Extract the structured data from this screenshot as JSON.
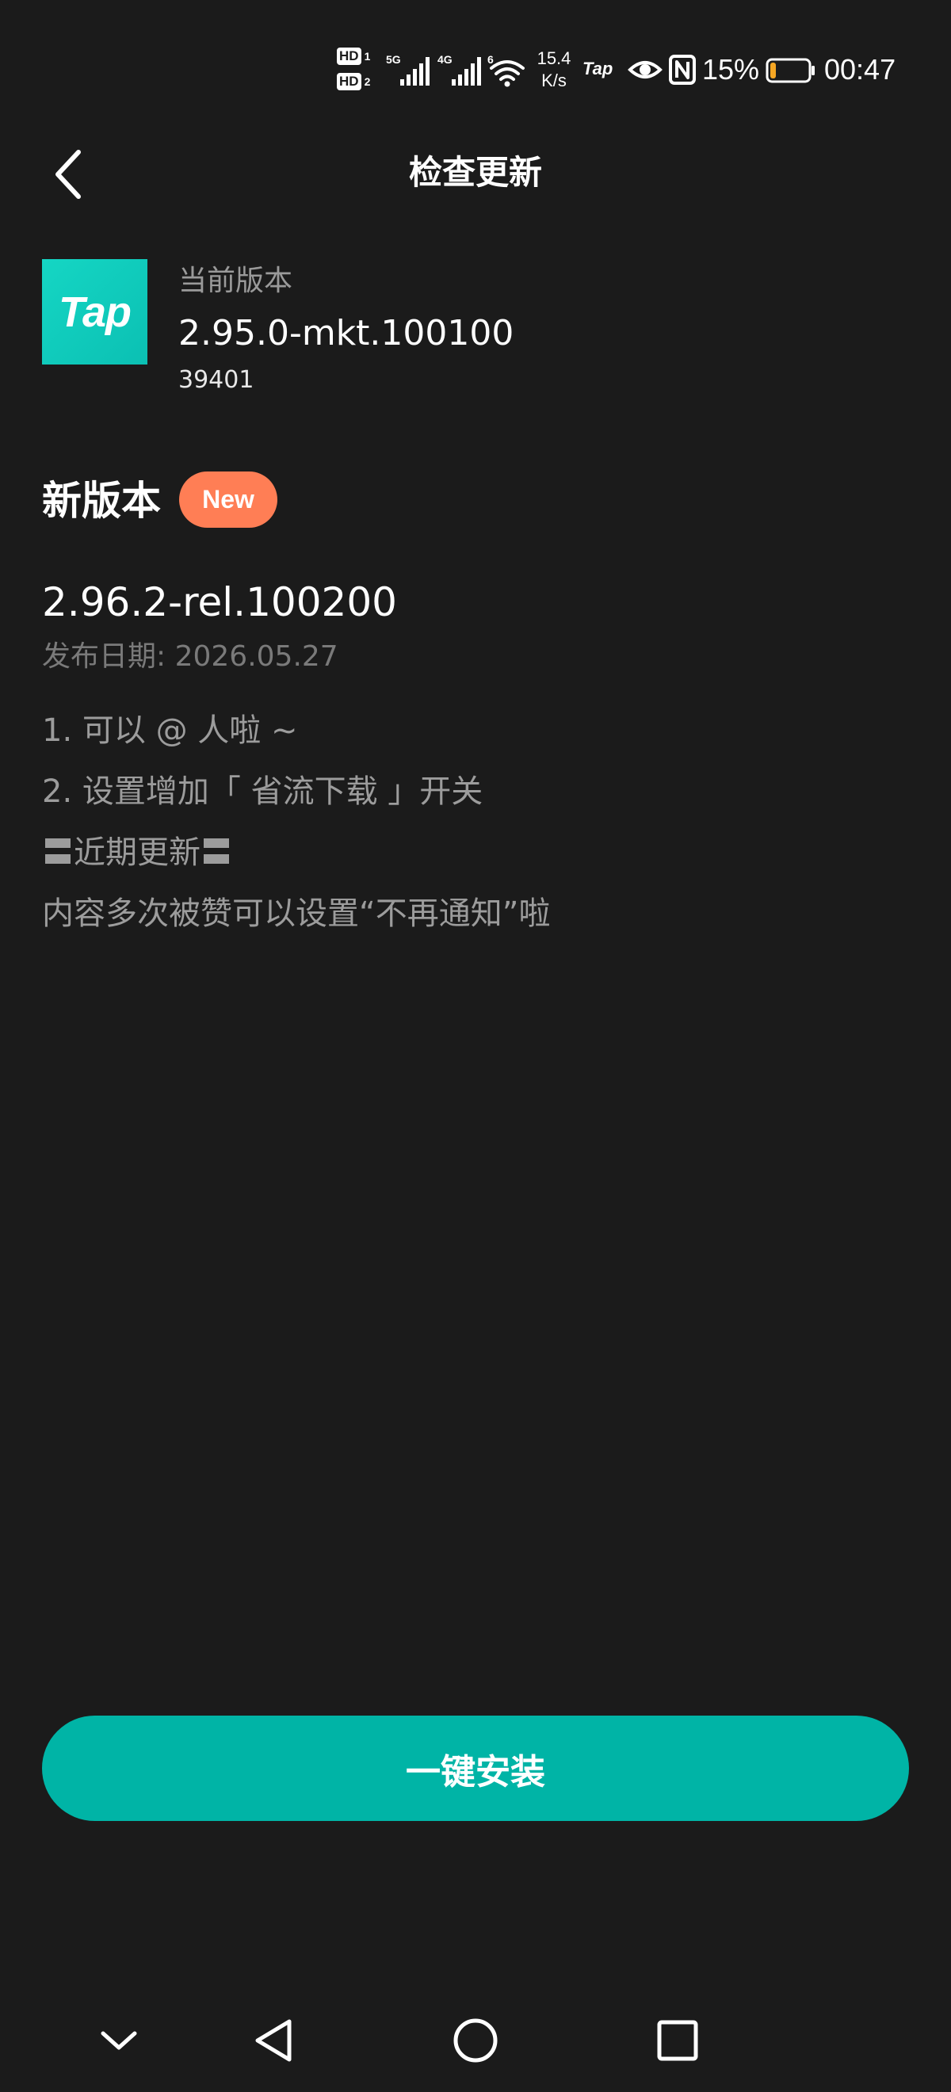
{
  "status_bar": {
    "hd1": "HD",
    "hd1_num": "1",
    "hd2": "HD",
    "hd2_num": "2",
    "net_5g": "5G",
    "net_4g": "4G",
    "wifi_badge": "6",
    "speed_value": "15.4",
    "speed_unit": "K/s",
    "tap_label": "Tap",
    "battery": "15%",
    "battery_level": 0.15,
    "time": "00:47",
    "battery_color": "#f5a623"
  },
  "header": {
    "title": "检查更新",
    "back_icon": "chevron-left-icon"
  },
  "current": {
    "logo_text": "Tap",
    "label": "当前版本",
    "version": "2.95.0-mkt.100100",
    "build": "39401"
  },
  "new_version": {
    "title": "新版本",
    "badge": "New",
    "version": "2.96.2-rel.100200",
    "release_date": "发布日期: 2026.05.27",
    "notes": [
      "1. 可以 @ 人啦 ~",
      "2. 设置增加「 省流下载 」开关",
      "〓近期更新〓",
      "内容多次被赞可以设置“不再通知”啦"
    ]
  },
  "install_button": {
    "label": "一键安装"
  },
  "colors": {
    "background": "#1b1b1b",
    "accent": "#00b4a6",
    "badge": "#ff7e55"
  },
  "nav": {
    "icons": [
      "chevron-down-icon",
      "back-triangle-icon",
      "home-circle-icon",
      "recents-square-icon"
    ]
  }
}
